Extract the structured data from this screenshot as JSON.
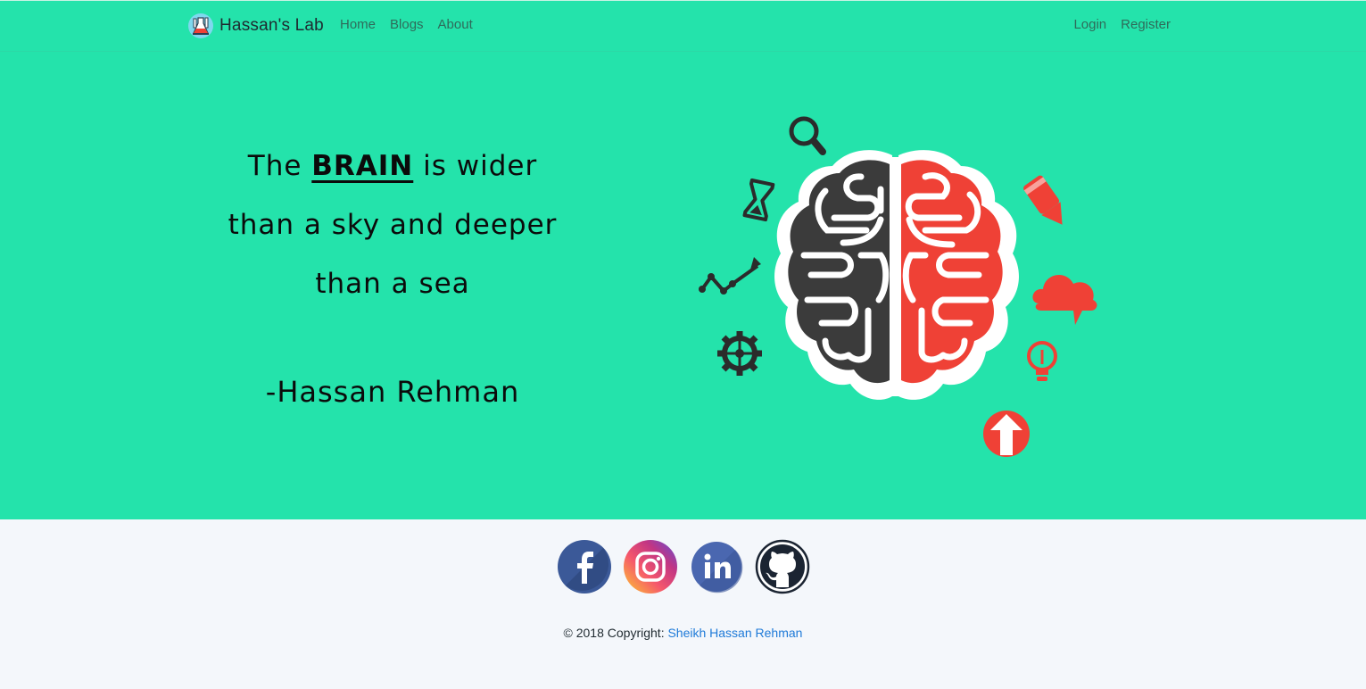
{
  "nav": {
    "brand": "Hassan's Lab",
    "left_links": [
      "Home",
      "Blogs",
      "About"
    ],
    "right_links": [
      "Login",
      "Register"
    ]
  },
  "hero": {
    "quote_line1_prefix": "The",
    "quote_line1_emph": "BRAIN",
    "quote_line1_suffix": "is wider",
    "quote_line2": "than a sky and deeper",
    "quote_line3": "than a sea",
    "author": "-Hassan Rehman",
    "illustration_icons": [
      "magnifier-icon",
      "hourglass-icon",
      "trend-icon",
      "gear-icon",
      "pencil-icon",
      "cloud-icon",
      "lightbulb-icon",
      "upload-arrow-icon"
    ]
  },
  "social": {
    "icons": [
      "facebook-icon",
      "instagram-icon",
      "linkedin-icon",
      "github-icon"
    ]
  },
  "footer": {
    "copyright_prefix": "© 2018 Copyright:",
    "copyright_link": "Sheikh Hassan Rehman"
  },
  "colors": {
    "teal": "#24e3ab",
    "footer_bg": "#f4f7fb",
    "link": "#1e7ad8",
    "brain_left": "#3b3b3b",
    "brain_right": "#ef4136"
  }
}
